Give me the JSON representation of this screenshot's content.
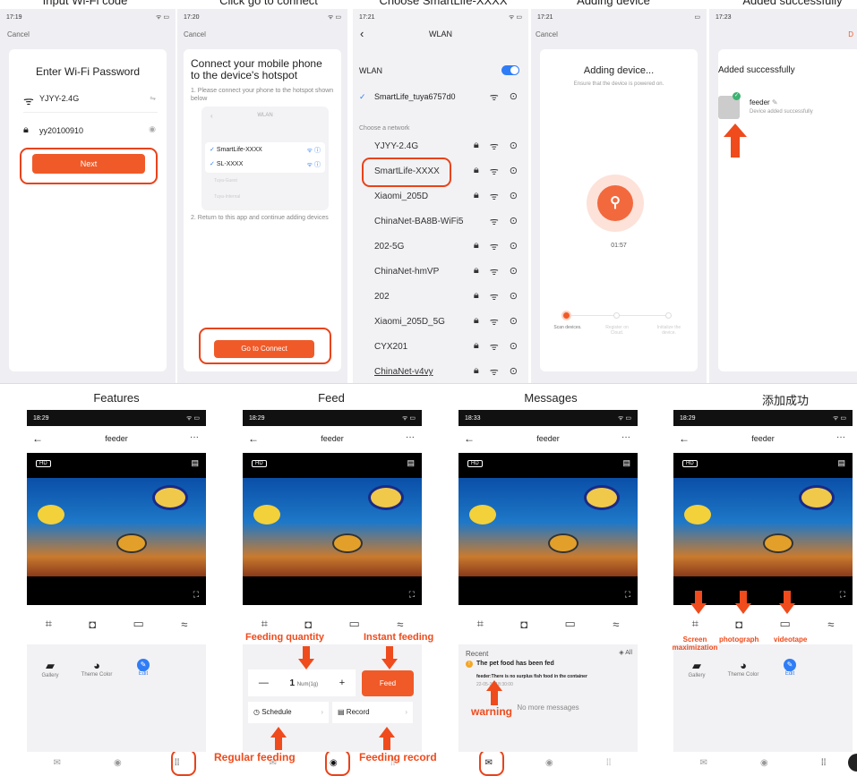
{
  "top_titles": [
    "Input Wi-Fi code",
    "Click go to connect",
    "Choose SmartLife-XXXX",
    "Adding device",
    "Added successfully"
  ],
  "p1": {
    "time": "17:19",
    "cancel": "Cancel",
    "title": "Enter Wi-Fi Password",
    "ssid": "YJYY-2.4G",
    "password": "yy20100910",
    "next": "Next"
  },
  "p2": {
    "time": "17:20",
    "cancel": "Cancel",
    "title": "Connect your mobile phone to the device's hotspot",
    "step1": "1. Please connect your phone to the hotspot shown below",
    "mini_title": "WLAN",
    "mini_items": [
      "SmartLife-XXXX",
      "SL-XXXX"
    ],
    "mini_faded": [
      "Tuya-Guest",
      "Tuya-Internal"
    ],
    "step2": "2. Return to this app and continue adding devices",
    "button": "Go to Connect"
  },
  "p3": {
    "time": "17:21",
    "title": "WLAN",
    "wlan_label": "WLAN",
    "connected": "SmartLife_tuya6757d0",
    "choose": "Choose a network",
    "networks": [
      "YJYY-2.4G",
      "SmartLife-XXXX",
      "Xiaomi_205D",
      "ChinaNet-BA8B-WiFi5",
      "202-5G",
      "ChinaNet-hmVP",
      "202",
      "Xiaomi_205D_5G",
      "CYX201",
      "ChinaNet-v4vy"
    ]
  },
  "p4": {
    "time": "17:21",
    "cancel": "Cancel",
    "title": "Adding device...",
    "subtitle": "Ensure that the device is powered on.",
    "timer": "01:57",
    "steps": [
      "Scan devices.",
      "Register on Cloud.",
      "Initialize the device."
    ]
  },
  "p5": {
    "time": "17:23",
    "title": "Added successfully",
    "device": "feeder",
    "status": "Device added successfully",
    "done": "D"
  },
  "bottom_titles": [
    "Features",
    "Feed",
    "Messages",
    "添加成功"
  ],
  "screen": {
    "times": [
      "18:29",
      "18:29",
      "18:33",
      "18:29"
    ],
    "title": "feeder",
    "more": "···",
    "hd": "HD"
  },
  "features": {
    "items": [
      "Gallery",
      "Theme Color",
      "Edit"
    ]
  },
  "feed": {
    "num": "1",
    "unit": "Num(1g)",
    "feed_btn": "Feed",
    "schedule": "Schedule",
    "record": "Record"
  },
  "messages": {
    "recent": "Recent",
    "all": "All",
    "msg_title": "The pet food has been fed",
    "msg_body": "feeder:There is no surplus fish food in the container",
    "msg_time": "22-05-30 18:30:00",
    "no_more": "No more messages"
  },
  "annotations": {
    "feeding_quantity": "Feeding quantity",
    "instant_feeding": "Instant feeding",
    "regular_feeding": "Regular feeding",
    "feeding_record": "Feeding record",
    "warning": "warning",
    "screen_max": "Screen maximization",
    "photograph": "photograph",
    "videotape": "videotape"
  },
  "colors": {
    "accent": "#f05a28",
    "annotation": "#ef4b1c",
    "blue": "#2f7df6"
  }
}
